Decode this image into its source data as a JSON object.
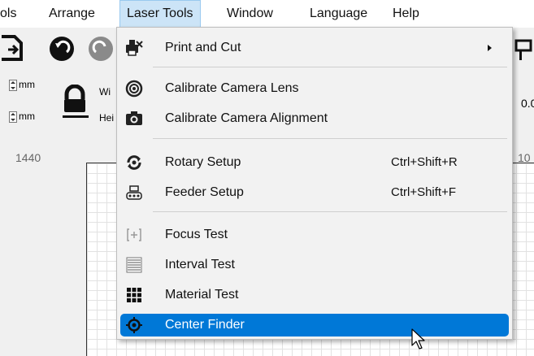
{
  "menubar": {
    "items": [
      {
        "label": "ols"
      },
      {
        "label": "Arrange"
      },
      {
        "label": "Laser Tools"
      },
      {
        "label": "Window"
      },
      {
        "label": "Language"
      },
      {
        "label": "Help"
      }
    ]
  },
  "props": {
    "unit1": "mm",
    "unit2": "mm",
    "width_label": "Wi",
    "height_label": "Hei",
    "partial_right": "0.0"
  },
  "ruler": {
    "left_number": "1440",
    "right_number": "10"
  },
  "dropdown": {
    "items": [
      {
        "label": "Print and Cut",
        "shortcut": "",
        "icon": "printer-cut-icon",
        "submenu": true
      },
      {
        "label": "Calibrate Camera Lens",
        "shortcut": "",
        "icon": "camera-lens-icon"
      },
      {
        "label": "Calibrate Camera Alignment",
        "shortcut": "",
        "icon": "camera-icon"
      },
      {
        "label": "Rotary Setup",
        "shortcut": "Ctrl+Shift+R",
        "icon": "rotary-icon"
      },
      {
        "label": "Feeder Setup",
        "shortcut": "Ctrl+Shift+F",
        "icon": "feeder-icon"
      },
      {
        "label": "Focus Test",
        "shortcut": "",
        "icon": "focus-icon"
      },
      {
        "label": "Interval Test",
        "shortcut": "",
        "icon": "interval-icon"
      },
      {
        "label": "Material Test",
        "shortcut": "",
        "icon": "grid-icon"
      },
      {
        "label": "Center Finder",
        "shortcut": "",
        "icon": "target-icon",
        "selected": true
      }
    ]
  },
  "colors": {
    "selection": "#0078d7",
    "menu_active": "#cce4f7"
  }
}
